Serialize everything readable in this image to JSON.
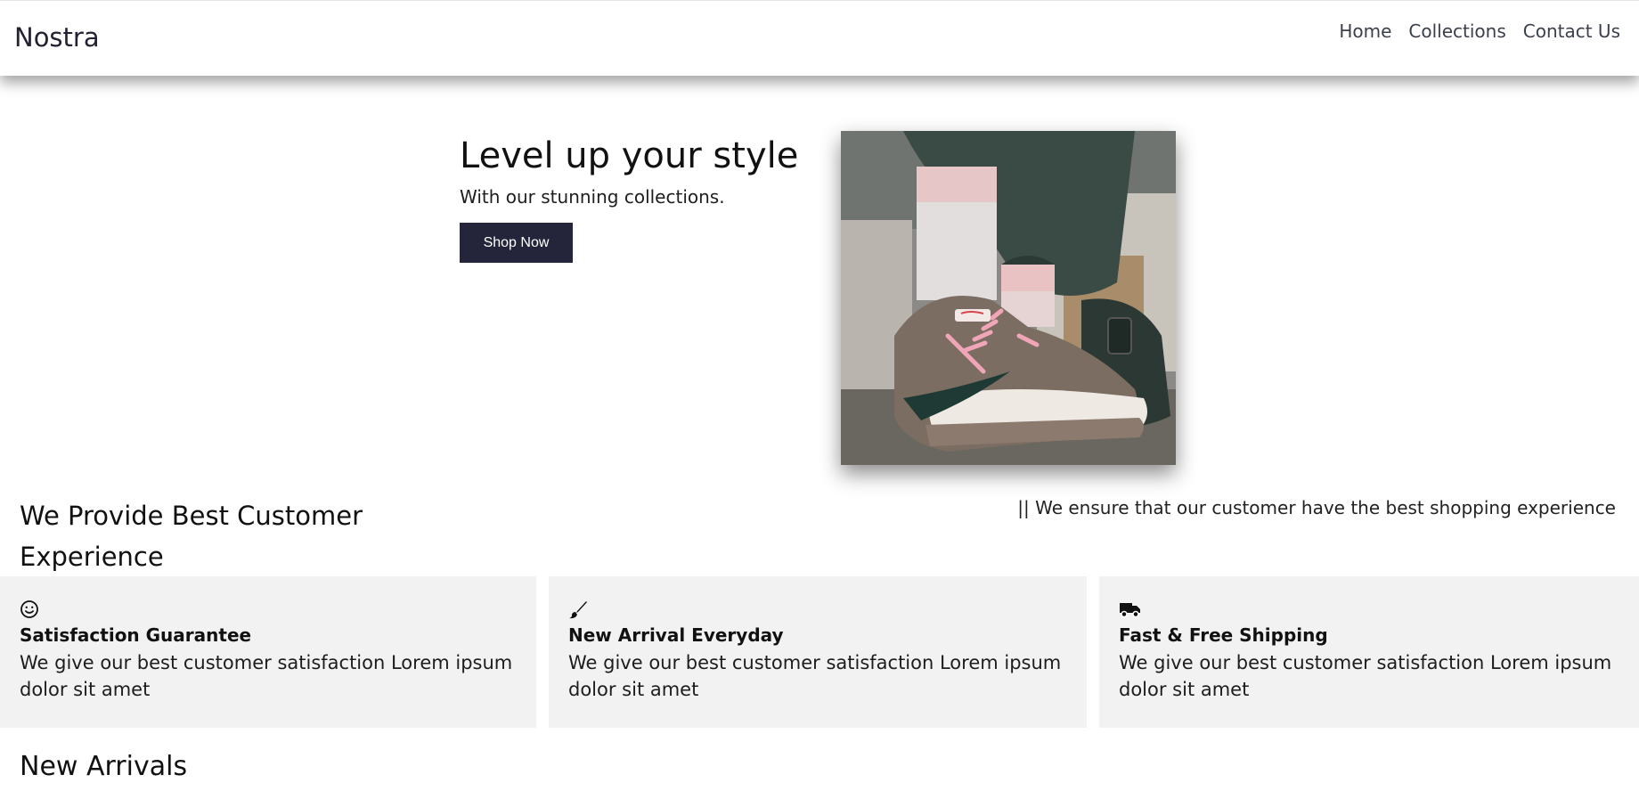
{
  "brand": "Nostra",
  "nav": {
    "items": [
      {
        "label": "Home"
      },
      {
        "label": "Collections"
      },
      {
        "label": "Contact Us"
      }
    ]
  },
  "hero": {
    "title": "Level up your style",
    "subtitle": "With our stunning collections.",
    "cta_label": "Shop Now"
  },
  "experience": {
    "title": "We Provide Best Customer Experience",
    "note": "|| We ensure that our customer have the best shopping experience"
  },
  "features": [
    {
      "icon": "smile-icon",
      "title": "Satisfaction Guarantee",
      "desc": "We give our best customer satisfaction Lorem ipsum dolor sit amet"
    },
    {
      "icon": "paintbrush-icon",
      "title": "New Arrival Everyday",
      "desc": "We give our best customer satisfaction Lorem ipsum dolor sit amet"
    },
    {
      "icon": "truck-icon",
      "title": "Fast & Free Shipping",
      "desc": "We give our best customer satisfaction Lorem ipsum dolor sit amet"
    }
  ],
  "new_arrivals": {
    "title": "New Arrivals"
  },
  "colors": {
    "accent": "#24253a",
    "card_bg": "#f1f2f1",
    "nav_text": "#3a3f4b"
  }
}
